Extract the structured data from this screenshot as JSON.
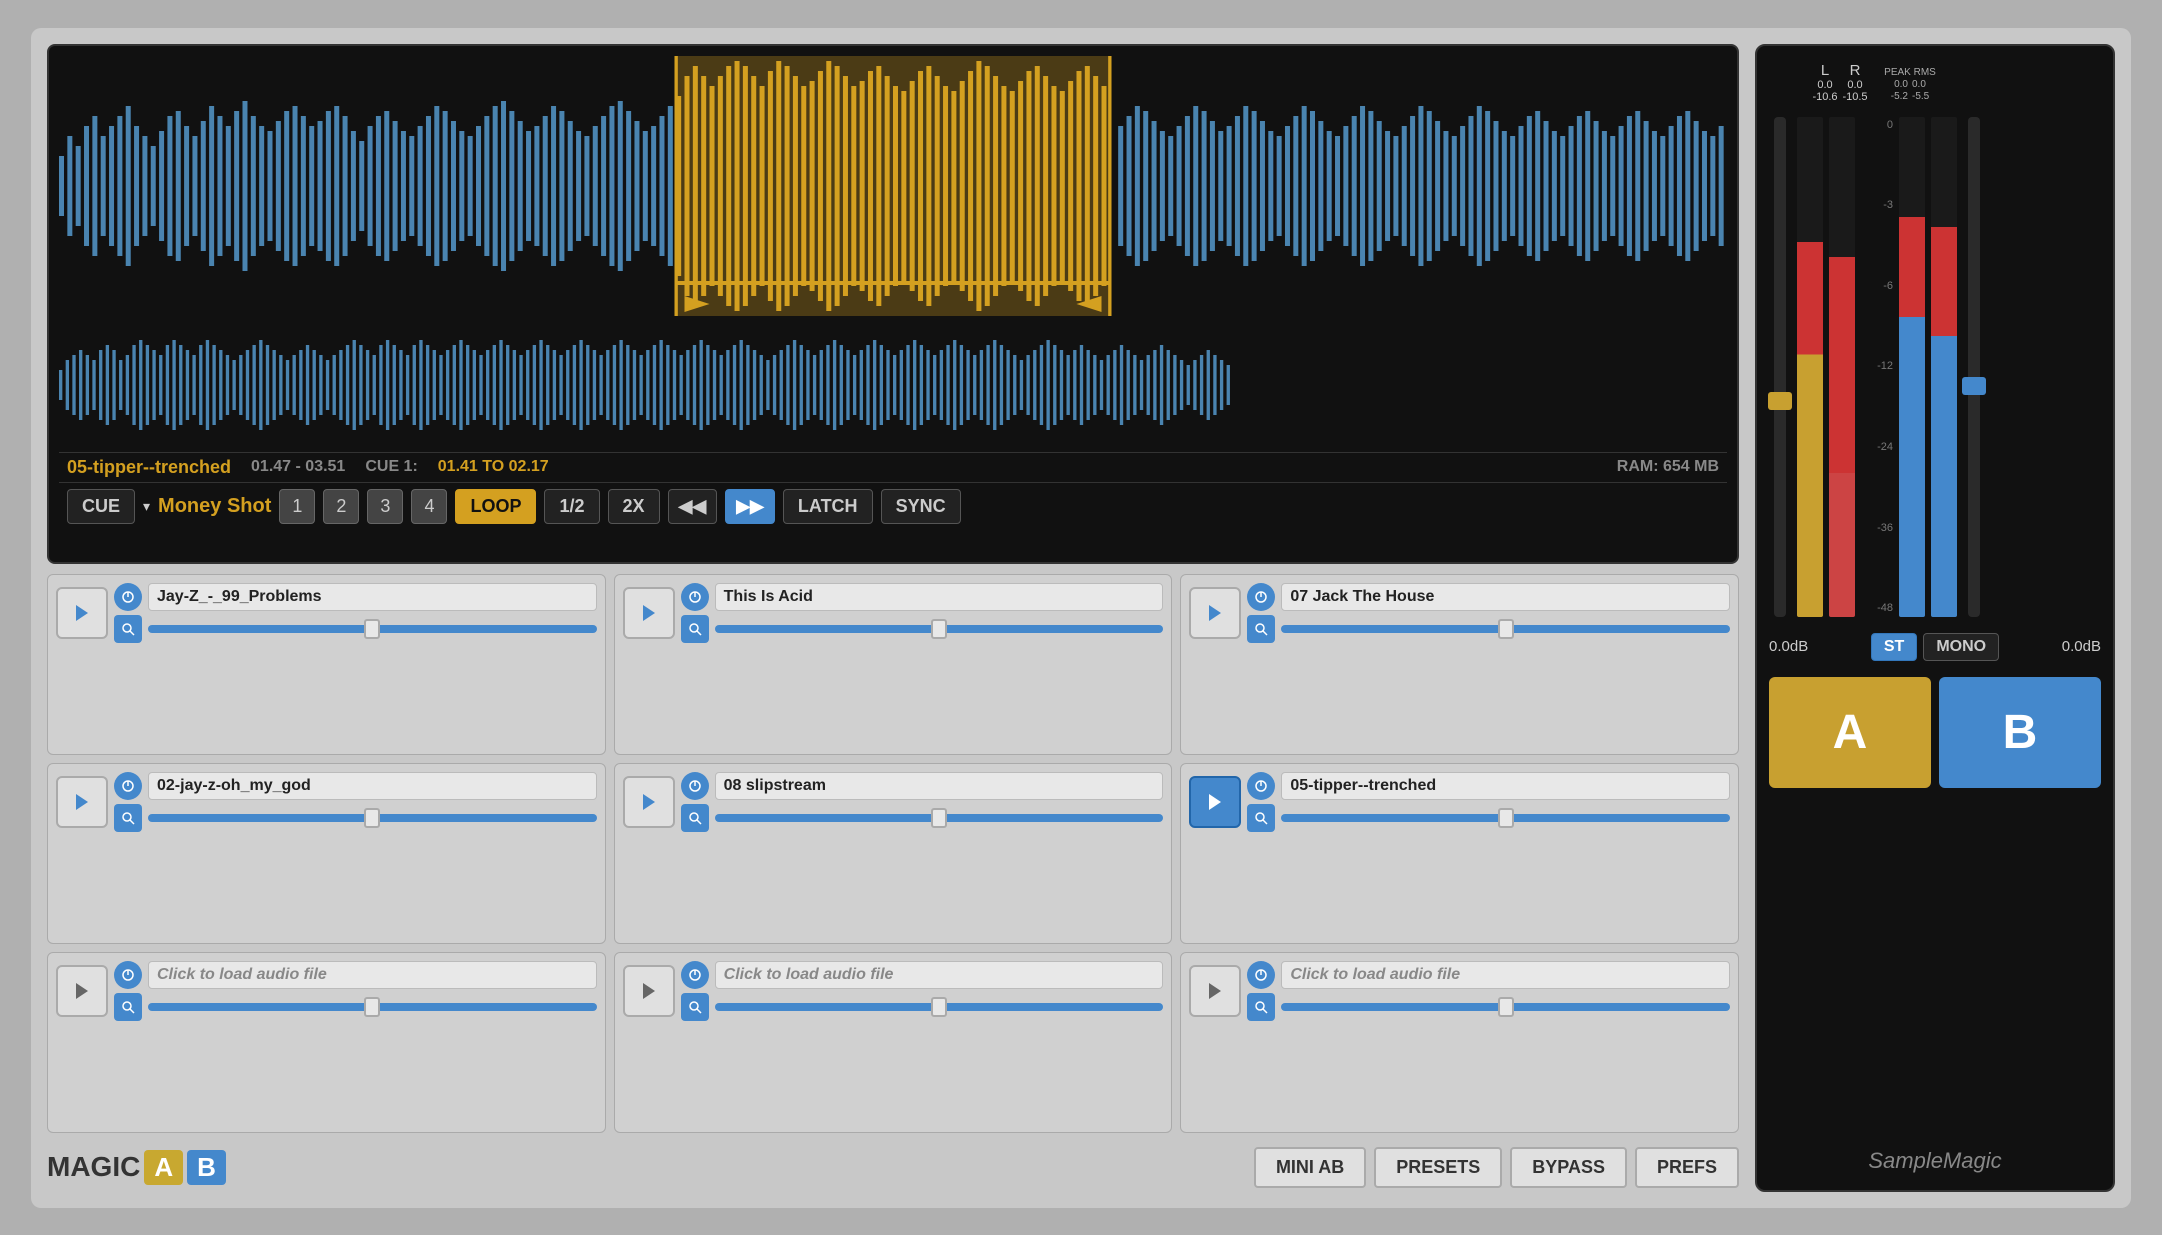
{
  "app": {
    "title": "Magic AB - Sample Magic"
  },
  "waveform": {
    "filename": "05-tipper--trenched",
    "time_range": "01.47 - 03.51",
    "cue_label": "CUE 1:",
    "cue_range": "01.41 TO 02.17",
    "ram": "RAM: 654 MB",
    "cue_btn": "CUE",
    "cue_name": "Money Shot",
    "loop_btn": "LOOP",
    "half_btn": "1/2",
    "two_btn": "2X",
    "latch_btn": "LATCH",
    "sync_btn": "SYNC",
    "num1": "1",
    "num2": "2",
    "num3": "3",
    "num4": "4"
  },
  "slots": {
    "row1": [
      {
        "name": "Jay-Z_-_99_Problems",
        "empty": false
      },
      {
        "name": "This Is Acid",
        "empty": false
      },
      {
        "name": "07 Jack The House",
        "empty": false
      }
    ],
    "row2": [
      {
        "name": "02-jay-z-oh_my_god",
        "empty": false
      },
      {
        "name": "08 slipstream",
        "empty": false
      },
      {
        "name": "05-tipper--trenched",
        "empty": false
      }
    ],
    "row3": [
      {
        "name": "Click to load audio file",
        "empty": true
      },
      {
        "name": "Click to load audio file",
        "empty": true
      },
      {
        "name": "Click to load audio file",
        "empty": true
      }
    ]
  },
  "bottom_bar": {
    "magic": "MAGIC",
    "a": "A",
    "b": "B",
    "mini_ab": "MINI AB",
    "presets": "PRESETS",
    "bypass": "BYPASS",
    "prefs": "PREFS"
  },
  "meters": {
    "left_label": "L",
    "right_label": "R",
    "peak_rms_label": "PEAK RMS",
    "left2_label": "L",
    "right2_label": "R",
    "l_val": "0.0",
    "r_val": "0.0",
    "l_db": "-10.6",
    "r_db": "-10.5",
    "peak_val": "0.0",
    "rms_val": "0.0",
    "peak_l": "-5.2",
    "peak_r": "-5.5",
    "scale": [
      "0",
      "-3",
      "-6",
      "-12",
      "-24",
      "-36",
      "-48"
    ],
    "left_fader_db": "0.0dB",
    "right_fader_db": "0.0dB",
    "st_label": "ST",
    "mono_label": "MONO",
    "a_label": "A",
    "b_label": "B",
    "brand": "SampleMagic"
  }
}
